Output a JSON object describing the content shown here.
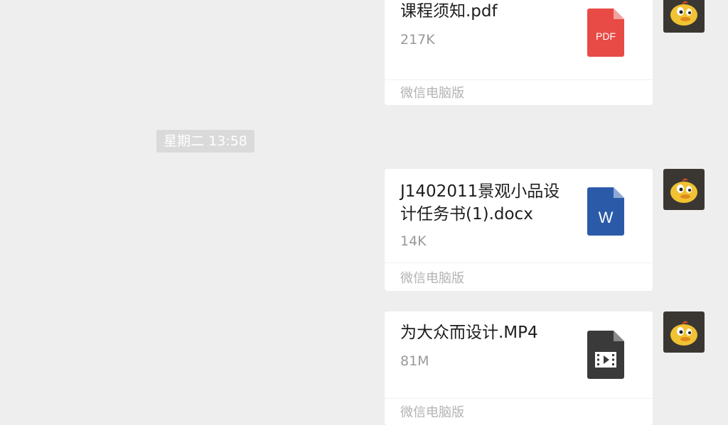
{
  "messages": [
    {
      "file_name": "课程须知.pdf",
      "file_size": "217K",
      "source": "微信电脑版",
      "file_type": "pdf",
      "icon_label": "PDF",
      "icon_color": "#e84a46"
    },
    {
      "file_name": "J1402011景观小品设计任务书(1).docx",
      "file_size": "14K",
      "source": "微信电脑版",
      "file_type": "docx",
      "icon_label": "W",
      "icon_color": "#2b5aa9"
    },
    {
      "file_name": "为大众而设计.MP4",
      "file_size": "81M",
      "source": "微信电脑版",
      "file_type": "mp4",
      "icon_color": "#3a3a3a"
    }
  ],
  "timestamp": "星期二 13:58",
  "colors": {
    "background": "#eeeeee",
    "card": "#ffffff",
    "timestamp_bg": "#dadada"
  }
}
